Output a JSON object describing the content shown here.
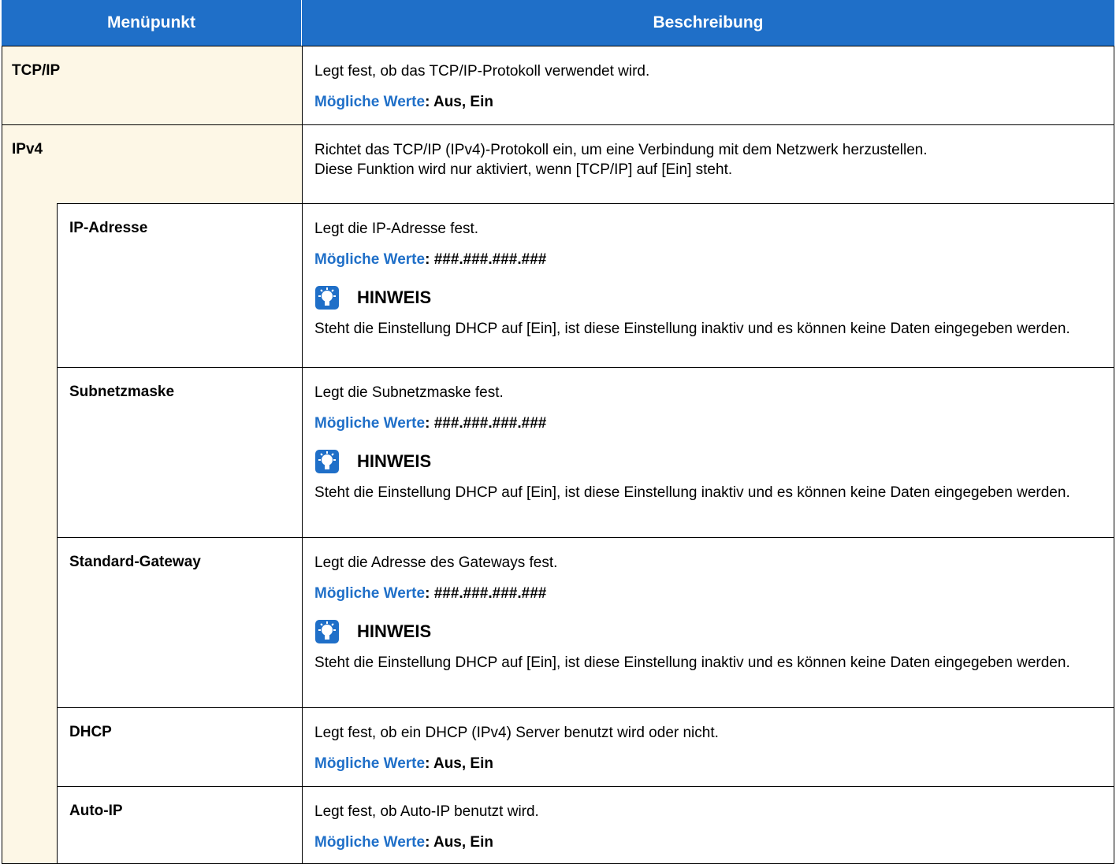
{
  "header": {
    "col1": "Menüpunkt",
    "col2": "Beschreibung"
  },
  "values_label": "Mögliche Werte",
  "rows": {
    "tcpip": {
      "name": "TCP/IP",
      "desc": "Legt fest, ob das TCP/IP-Protokoll verwendet wird.",
      "values": "Aus, Ein"
    },
    "ipv4": {
      "name": "IPv4",
      "desc1": "Richtet das TCP/IP (IPv4)-Protokoll ein, um eine Verbindung mit dem Netzwerk herzustellen.",
      "desc2": "Diese Funktion wird nur aktiviert, wenn [TCP/IP] auf [Ein] steht."
    },
    "ipaddr": {
      "name": "IP-Adresse",
      "desc": "Legt die IP-Adresse fest.",
      "values": "###.###.###.###",
      "note_title": "HINWEIS",
      "note": "Steht die Einstellung DHCP auf [Ein], ist diese Einstellung inaktiv und es können keine Daten eingegeben werden."
    },
    "subnet": {
      "name": "Subnetzmaske",
      "desc": "Legt die Subnetzmaske fest.",
      "values": "###.###.###.###",
      "note_title": "HINWEIS",
      "note": "Steht die Einstellung DHCP auf [Ein], ist diese Einstellung inaktiv und es können keine Daten eingegeben werden."
    },
    "gateway": {
      "name": "Standard-Gateway",
      "desc": "Legt die Adresse des Gateways fest.",
      "values": "###.###.###.###",
      "note_title": "HINWEIS",
      "note": "Steht die Einstellung DHCP auf [Ein], ist diese Einstellung inaktiv und es können keine Daten eingegeben werden."
    },
    "dhcp": {
      "name": "DHCP",
      "desc": "Legt fest, ob ein DHCP (IPv4) Server benutzt wird oder nicht.",
      "values": "Aus, Ein"
    },
    "autoip": {
      "name": "Auto-IP",
      "desc": "Legt fest, ob Auto-IP benutzt wird.",
      "values": "Aus, Ein"
    }
  },
  "colors": {
    "header_bg": "#1f6fc8",
    "accent_text": "#1f6fc8",
    "shaded_bg": "#fdf7e6"
  },
  "icons": {
    "note": "lightbulb-note-icon"
  }
}
